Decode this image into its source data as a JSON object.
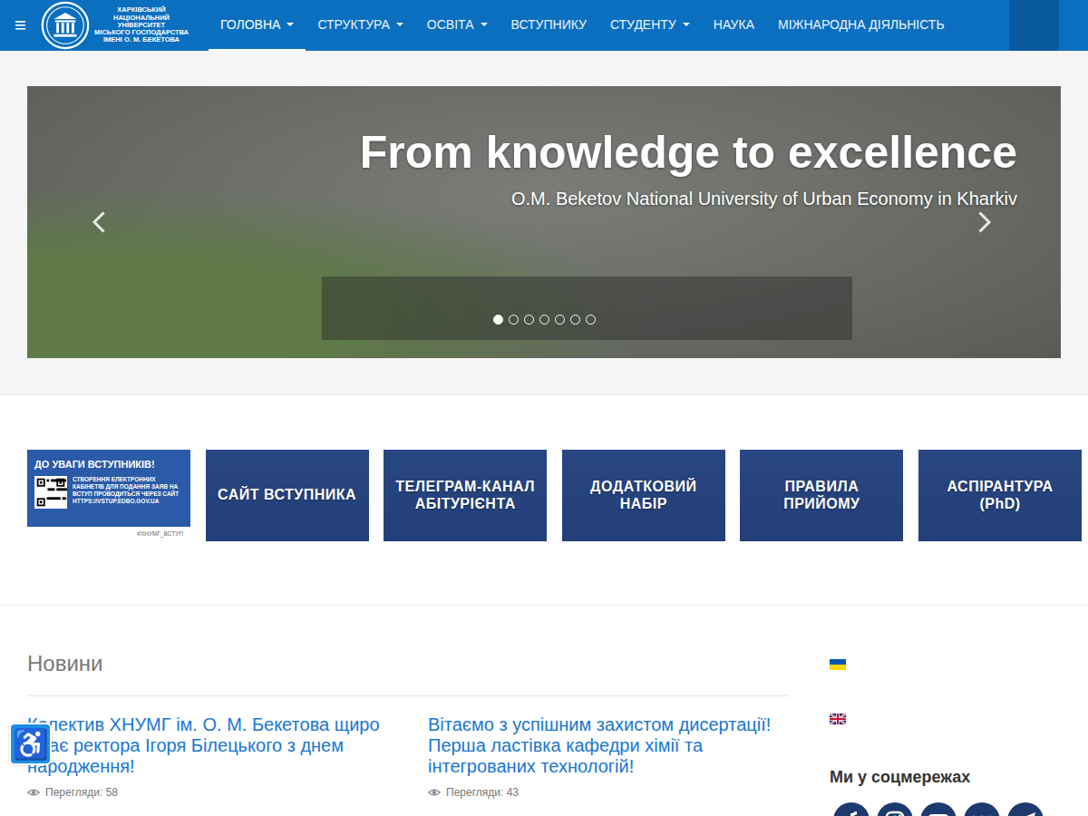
{
  "navbar": {
    "menu_icon": "≡",
    "logo_lines": [
      "ХАРКІВСЬКИЙ",
      "НАЦІОНАЛЬНИЙ",
      "УНІВЕРСИТЕТ",
      "МІСЬКОГО ГОСПОДАРСТВА",
      "ІМЕНІ О. М. БЕКЕТОВА"
    ],
    "items": [
      {
        "label": "ГОЛОВНА",
        "dropdown": true,
        "selected": true
      },
      {
        "label": "СТРУКТУРА",
        "dropdown": true,
        "selected": false
      },
      {
        "label": "ОСВІТА",
        "dropdown": true,
        "selected": false
      },
      {
        "label": "ВСТУПНИКУ",
        "dropdown": false,
        "selected": false
      },
      {
        "label": "СТУДЕНТУ",
        "dropdown": true,
        "selected": false
      },
      {
        "label": "НАУКА",
        "dropdown": false,
        "selected": false
      },
      {
        "label": "МІЖНАРОДНА ДІЯЛЬНІСТЬ",
        "dropdown": false,
        "selected": false
      }
    ]
  },
  "slider": {
    "caption": "From knowledge to excellence",
    "subtitle": "O.M. Beketov National University of Urban Economy in Kharkiv",
    "slides": [
      {
        "selected": true
      },
      {
        "selected": false
      },
      {
        "selected": false
      },
      {
        "selected": false
      },
      {
        "selected": false
      },
      {
        "selected": false
      },
      {
        "selected": false
      }
    ]
  },
  "banners": [
    {
      "kind": "qr",
      "title": "ДО УВАГИ ВСТУПНИКІВ!",
      "detail": "СТВОРЕННЯ ЕЛЕКТРОННИХ КАБІНЕТІВ ДЛЯ ПОДАННЯ ЗАЯВ НА ВСТУП ПРОВОДИТЬСЯ ЧЕРЕЗ САЙТ HTTPS://VSTUP.EDBO.GOV.UA",
      "tag": "#ХНУМГ_ВСТУП"
    },
    {
      "kind": "plain",
      "title": "САЙТ ВСТУПНИКА"
    },
    {
      "kind": "plain",
      "title": "ТЕЛЕГРАМ-КАНАЛ АБІТУРІЄНТА"
    },
    {
      "kind": "plain",
      "title": "ДОДАТКОВИЙ НАБІР"
    },
    {
      "kind": "plain",
      "title": "ПРАВИЛА ПРИЙОМУ"
    },
    {
      "kind": "plain",
      "title": "АСПІРАНТУРА (PhD)"
    }
  ],
  "news": {
    "heading": "Новини",
    "items": [
      {
        "title": "Колектив ХНУМГ ім. О. М. Бекетова щиро вітає ректора Ігоря Білецького з днем народження!",
        "views": "Перегляди: 58"
      },
      {
        "title": "Вітаємо з успішним захистом дисертації! Перша ластівка кафедри хімії та інтегрованих технологій!",
        "views": "Перегляди: 43"
      }
    ]
  },
  "languages": [
    {
      "kind": "ua"
    },
    {
      "kind": "gb"
    }
  ],
  "social": {
    "heading": "Ми у соцмережах",
    "networks": [
      {
        "kind": "facebook"
      },
      {
        "kind": "instagram"
      },
      {
        "kind": "youtube"
      },
      {
        "kind": "vk"
      },
      {
        "kind": "telegram"
      }
    ]
  },
  "accessibility": {
    "icon": "♿"
  }
}
